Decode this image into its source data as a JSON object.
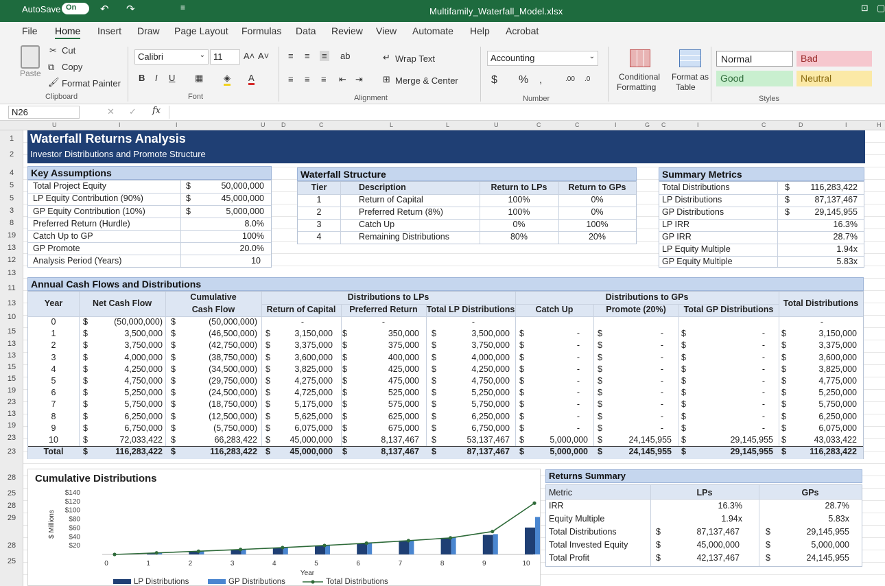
{
  "title_bar": {
    "autosave_label": "AutoSave",
    "autosave_state": "On",
    "filename": "Multifamily_Waterfall_Model.xlsx"
  },
  "menu": [
    "File",
    "Home",
    "Insert",
    "Draw",
    "Page Layout",
    "Formulas",
    "Data",
    "Review",
    "View",
    "Automate",
    "Help",
    "Acrobat"
  ],
  "ribbon": {
    "clipboard": {
      "paste": "Paste",
      "cut": "Cut",
      "copy": "Copy",
      "format_painter": "Format Painter",
      "group": "Clipboard"
    },
    "font": {
      "name": "Calibri",
      "size": "11",
      "group": "Font"
    },
    "alignment": {
      "wrap": "Wrap Text",
      "merge": "Merge & Center",
      "group": "Alignment"
    },
    "number": {
      "format": "Accounting",
      "group": "Number"
    },
    "cond": {
      "conditional": "Conditional",
      "formatting": "Formatting",
      "format_as": "Format as",
      "table": "Table"
    },
    "styles": {
      "normal": "Normal",
      "bad": "Bad",
      "good": "Good",
      "neutral": "Neutral",
      "group": "Styles"
    }
  },
  "formula_bar": {
    "name_box": "N26",
    "fx": "fx",
    "cancel": "✕",
    "confirm": "✓"
  },
  "column_letters": [
    "U",
    "I",
    "I",
    "U",
    "D",
    "C",
    "L",
    "L",
    "U",
    "C",
    "C",
    "I",
    "G",
    "C",
    "I",
    "C",
    "D",
    "I",
    "H"
  ],
  "row_numbers": [
    "1",
    "2",
    "4",
    "5",
    "5",
    "3",
    "8",
    "19",
    "13",
    "12",
    "13",
    "11",
    "13",
    "10",
    "15",
    "13",
    "13",
    "15",
    "15",
    "19",
    "23",
    "13",
    "19",
    "23",
    "23",
    "28",
    "25",
    "28",
    "29",
    "28",
    "25"
  ],
  "sheet": {
    "title": "Waterfall Returns Analysis",
    "subtitle": "Investor Distributions and Promote Structure",
    "key_assumptions": {
      "title": "Key Assumptions",
      "rows": [
        {
          "label": "Total Project Equity",
          "cur": "$",
          "value": "50,000,000"
        },
        {
          "label": "LP Equity Contribution (90%)",
          "cur": "$",
          "value": "45,000,000"
        },
        {
          "label": "GP Equity Contribution (10%)",
          "cur": "$",
          "value": "5,000,000"
        },
        {
          "label": "Preferred Return (Hurdle)",
          "cur": "",
          "value": "8.0%"
        },
        {
          "label": "Catch Up to GP",
          "cur": "",
          "value": "100%"
        },
        {
          "label": "GP Promote",
          "cur": "",
          "value": "20.0%"
        },
        {
          "label": "Analysis Period (Years)",
          "cur": "",
          "value": "10"
        }
      ]
    },
    "waterfall": {
      "title": "Waterfall Structure",
      "headers": [
        "Tier",
        "Description",
        "Return to LPs",
        "Return to GPs"
      ],
      "rows": [
        [
          "1",
          "Return of Capital",
          "100%",
          "0%"
        ],
        [
          "2",
          "Preferred Return (8%)",
          "100%",
          "0%"
        ],
        [
          "3",
          "Catch Up",
          "0%",
          "100%"
        ],
        [
          "4",
          "Remaining Distributions",
          "80%",
          "20%"
        ]
      ]
    },
    "summary": {
      "title": "Summary Metrics",
      "rows": [
        {
          "label": "Total Distributions",
          "cur": "$",
          "value": "116,283,422"
        },
        {
          "label": "LP Distributions",
          "cur": "$",
          "value": "87,137,467"
        },
        {
          "label": "GP Distributions",
          "cur": "$",
          "value": "29,145,955"
        },
        {
          "label": "LP IRR",
          "cur": "",
          "value": "16.3%"
        },
        {
          "label": "GP IRR",
          "cur": "",
          "value": "28.7%"
        },
        {
          "label": "LP Equity Multiple",
          "cur": "",
          "value": "1.94x"
        },
        {
          "label": "GP Equity Multiple",
          "cur": "",
          "value": "5.83x"
        }
      ]
    },
    "cashflows": {
      "title": "Annual Cash Flows and Distributions",
      "h_year": "Year",
      "h_ncf": "Net Cash Flow",
      "h_cum1": "Cumulative",
      "h_cum2": "Cash Flow",
      "h_lp_group": "Distributions to LPs",
      "h_gp_group": "Distributions to GPs",
      "h_roc": "Return of Capital",
      "h_pref": "Preferred Return",
      "h_tlp": "Total LP Distributions",
      "h_catch": "Catch Up",
      "h_promote": "Promote (20%)",
      "h_tgp": "Total GP Distributions",
      "h_total": "Total Distributions",
      "dash": "-",
      "cur": "$",
      "rows": [
        [
          "0",
          "(50,000,000)",
          "(50,000,000)",
          "-",
          "-",
          "-",
          "",
          "",
          "",
          "-"
        ],
        [
          "1",
          "3,500,000",
          "(46,500,000)",
          "3,150,000",
          "350,000",
          "3,500,000",
          "-",
          "-",
          "-",
          "3,150,000"
        ],
        [
          "2",
          "3,750,000",
          "(42,750,000)",
          "3,375,000",
          "375,000",
          "3,750,000",
          "-",
          "-",
          "-",
          "3,375,000"
        ],
        [
          "3",
          "4,000,000",
          "(38,750,000)",
          "3,600,000",
          "400,000",
          "4,000,000",
          "-",
          "-",
          "-",
          "3,600,000"
        ],
        [
          "4",
          "4,250,000",
          "(34,500,000)",
          "3,825,000",
          "425,000",
          "4,250,000",
          "-",
          "-",
          "-",
          "3,825,000"
        ],
        [
          "5",
          "4,750,000",
          "(29,750,000)",
          "4,275,000",
          "475,000",
          "4,750,000",
          "-",
          "-",
          "-",
          "4,775,000"
        ],
        [
          "6",
          "5,250,000",
          "(24,500,000)",
          "4,725,000",
          "525,000",
          "5,250,000",
          "-",
          "-",
          "-",
          "5,250,000"
        ],
        [
          "7",
          "5,750,000",
          "(18,750,000)",
          "5,175,000",
          "575,000",
          "5,750,000",
          "-",
          "-",
          "-",
          "5,750,000"
        ],
        [
          "8",
          "6,250,000",
          "(12,500,000)",
          "5,625,000",
          "625,000",
          "6,250,000",
          "-",
          "-",
          "-",
          "6,250,000"
        ],
        [
          "9",
          "6,750,000",
          "(5,750,000)",
          "6,075,000",
          "675,000",
          "6,750,000",
          "-",
          "-",
          "-",
          "6,075,000"
        ],
        [
          "10",
          "72,033,422",
          "66,283,422",
          "45,000,000",
          "8,137,467",
          "53,137,467",
          "5,000,000",
          "24,145,955",
          "29,145,955",
          "43,033,422"
        ]
      ],
      "total": [
        "Total",
        "116,283,422",
        "116,283,422",
        "45,000,000",
        "8,137,467",
        "87,137,467",
        "5,000,000",
        "24,145,955",
        "29,145,955",
        "116,283,422"
      ]
    },
    "returns_summary": {
      "title": "Returns Summary",
      "headers": [
        "Metric",
        "LPs",
        "GPs"
      ],
      "rows": [
        {
          "metric": "IRR",
          "lp_cur": "",
          "lp": "16.3%",
          "gp_cur": "",
          "gp": "28.7%"
        },
        {
          "metric": "Equity Multiple",
          "lp_cur": "",
          "lp": "1.94x",
          "gp_cur": "",
          "gp": "5.83x"
        },
        {
          "metric": "Total Distributions",
          "lp_cur": "$",
          "lp": "87,137,467",
          "gp_cur": "$",
          "gp": "29,145,955"
        },
        {
          "metric": "Total Invested Equity",
          "lp_cur": "$",
          "lp": "45,000,000",
          "gp_cur": "$",
          "gp": "5,000,000"
        },
        {
          "metric": "Total Profit",
          "lp_cur": "$",
          "lp": "42,137,467",
          "gp_cur": "$",
          "gp": "24,145,955"
        }
      ]
    }
  },
  "chart_data": {
    "type": "bar",
    "title": "Cumulative Distributions",
    "xlabel": "Year",
    "ylabel": "$ Millions",
    "categories": [
      "0",
      "1",
      "2",
      "3",
      "4",
      "5",
      "6",
      "7",
      "8",
      "9",
      "10"
    ],
    "y_ticks": [
      "$20",
      "$40",
      "$60",
      "$80",
      "$100",
      "$120",
      "$140"
    ],
    "ylim": [
      0,
      140
    ],
    "series": [
      {
        "name": "LP Distributions",
        "kind": "bar",
        "color": "#1f3f74",
        "values": [
          0,
          3.5,
          7.25,
          11.25,
          15.5,
          20.25,
          25.5,
          31.25,
          37.5,
          44.25,
          61
        ]
      },
      {
        "name": "GP Distributions",
        "kind": "bar",
        "color": "#4a86d0",
        "values": [
          0,
          3.5,
          7.5,
          11.5,
          16,
          21,
          26.5,
          32.5,
          39,
          46,
          85
        ]
      },
      {
        "name": "Total Distributions",
        "kind": "line",
        "color": "#2f6b3a",
        "values": [
          0,
          3.5,
          7.25,
          11.25,
          15.5,
          20.25,
          25.5,
          31.25,
          37.5,
          52,
          116.3
        ]
      }
    ],
    "legend_position": "bottom"
  }
}
